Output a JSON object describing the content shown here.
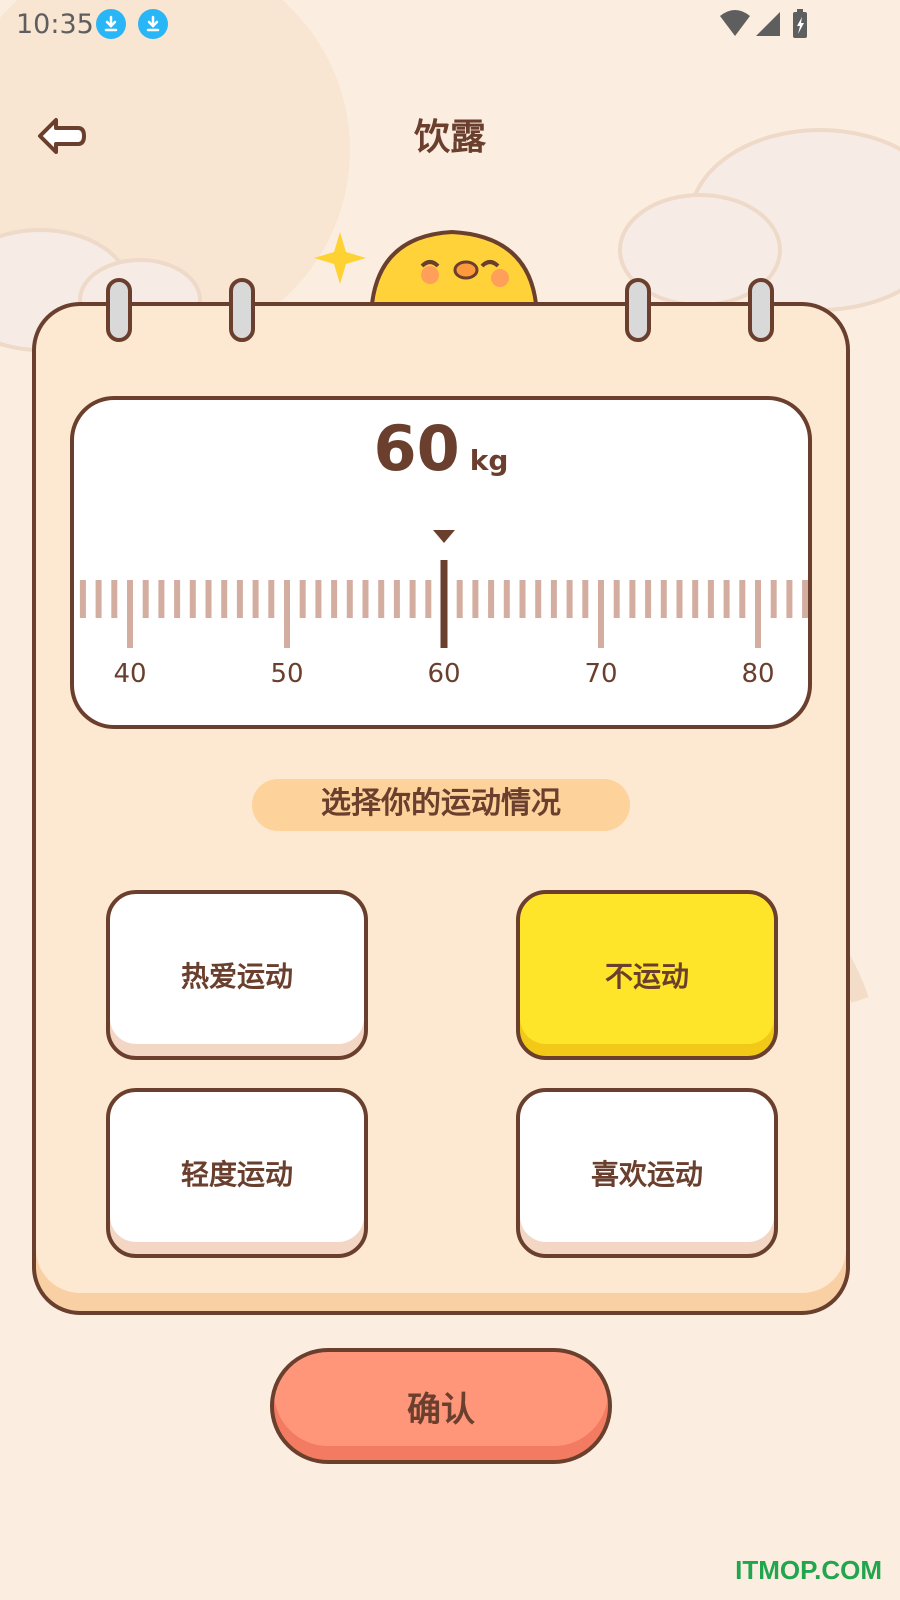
{
  "status_bar": {
    "time": "10:35",
    "icons": [
      "download-icon",
      "download-icon",
      "wifi-icon",
      "signal-icon",
      "battery-charging-icon"
    ]
  },
  "header": {
    "title": "饮露",
    "back_icon": "back-arrow-icon"
  },
  "weight": {
    "value": "60",
    "unit": "kg",
    "selected_value": 60,
    "ruler_min": 40,
    "ruler_max": 80,
    "ruler_labels": [
      "40",
      "50",
      "60",
      "70",
      "80"
    ]
  },
  "activity": {
    "label": "选择你的运动情况",
    "options": [
      {
        "label": "热爱运动",
        "selected": false
      },
      {
        "label": "不运动",
        "selected": true
      },
      {
        "label": "轻度运动",
        "selected": false
      },
      {
        "label": "喜欢运动",
        "selected": false
      }
    ]
  },
  "confirm": {
    "label": "确认"
  },
  "watermark": "ITMOP.COM",
  "colors": {
    "background": "#fbeee0",
    "card": "#fde9d2",
    "outline": "#6a3f2d",
    "selected_option": "#ffe52a",
    "confirm": "#ff967a",
    "tick": "#d4ada1",
    "label_bg": "#fdd29b"
  }
}
